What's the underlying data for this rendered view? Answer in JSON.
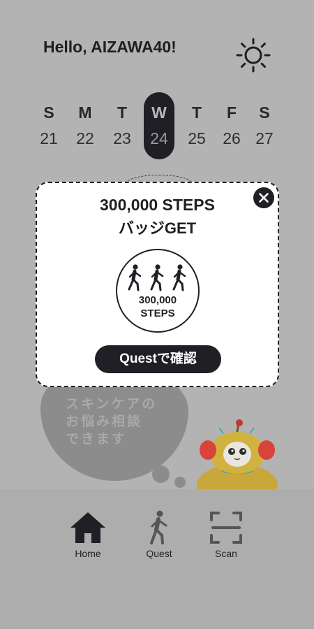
{
  "header": {
    "greeting": "Hello, AIZAWA40!",
    "theme_icon": "sun-icon"
  },
  "week": {
    "days": [
      {
        "dow": "S",
        "date": "21",
        "active": false
      },
      {
        "dow": "M",
        "date": "22",
        "active": false
      },
      {
        "dow": "T",
        "date": "23",
        "active": false
      },
      {
        "dow": "W",
        "date": "24",
        "active": true
      },
      {
        "dow": "T",
        "date": "25",
        "active": false
      },
      {
        "dow": "F",
        "date": "26",
        "active": false
      },
      {
        "dow": "S",
        "date": "27",
        "active": false
      }
    ]
  },
  "assistant": {
    "bubble_text_lines": [
      "スキンケアの",
      "お悩み相談",
      "できます"
    ],
    "mascot_icon": "robot-mascot-icon"
  },
  "modal": {
    "title": "300,000 STEPS",
    "subtitle": "バッジGET",
    "badge_line1": "300,000",
    "badge_line2": "STEPS",
    "badge_icon": "walking-people-icon",
    "close_icon": "close-icon",
    "button_label": "Questで確認"
  },
  "nav": {
    "items": [
      {
        "label": "Home",
        "icon": "home-icon"
      },
      {
        "label": "Quest",
        "icon": "walking-person-icon"
      },
      {
        "label": "Scan",
        "icon": "scan-icon"
      }
    ]
  },
  "colors": {
    "background": "#b3b3b3",
    "dark": "#1f1f25",
    "modal_bg": "#ffffff",
    "nav_bg": "#adadad",
    "blob": "#8c8c8c"
  }
}
